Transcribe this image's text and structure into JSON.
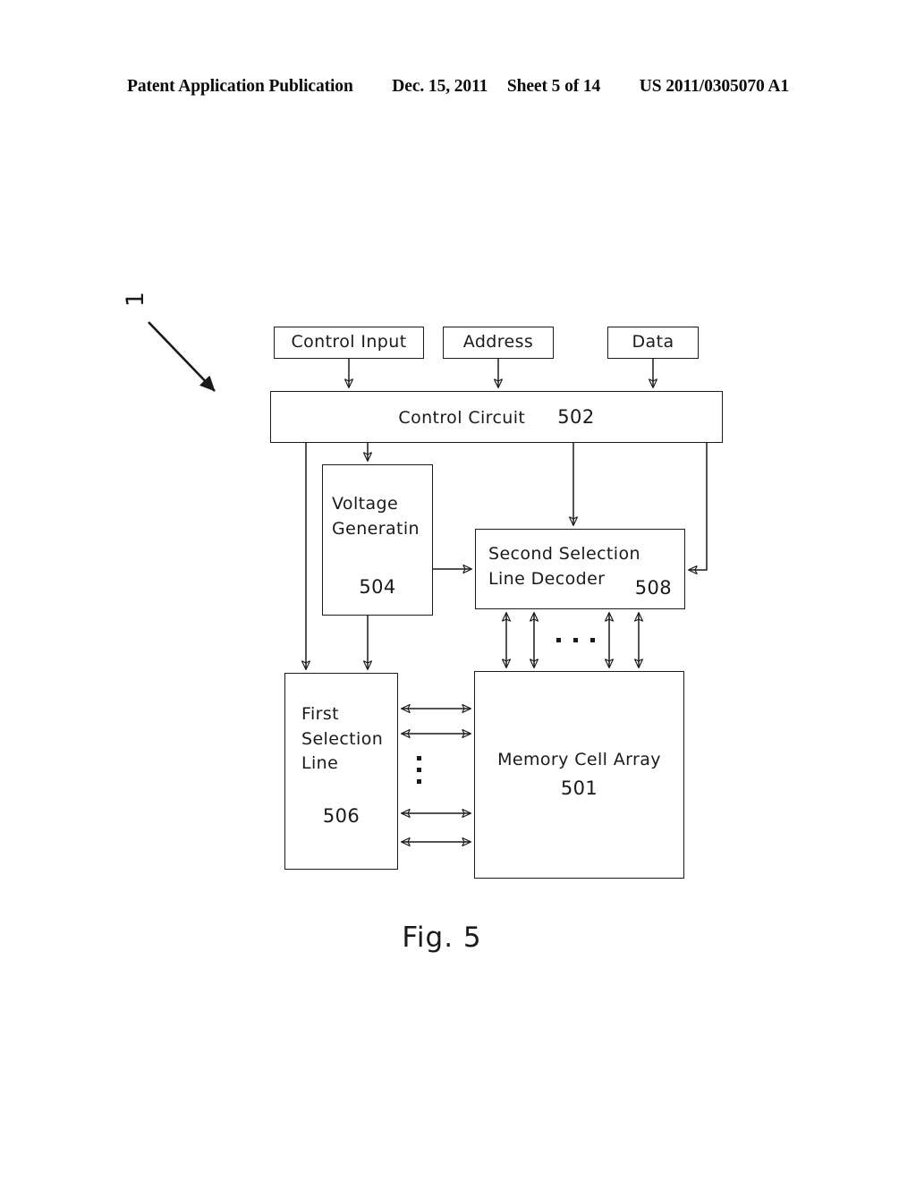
{
  "header": {
    "publication": "Patent Application Publication",
    "date": "Dec. 15, 2011",
    "sheet": "Sheet 5 of 14",
    "pub_number": "US 2011/0305070 A1"
  },
  "figure": {
    "caption": "Fig. 5",
    "system_ref": "1",
    "line_color": "#1a1a1a",
    "background": "#ffffff"
  },
  "blocks": {
    "control_input": {
      "label": "Control Input"
    },
    "address": {
      "label": "Address"
    },
    "data": {
      "label": "Data"
    },
    "control_circuit": {
      "label": "Control Circuit",
      "ref": "502"
    },
    "voltage_generation": {
      "line1": "Voltage",
      "line2": "Generatin",
      "ref": "504"
    },
    "second_selection_line_decoder": {
      "line1": "Second Selection",
      "line2": "Line Decoder",
      "ref": "508"
    },
    "first_selection_line": {
      "line1": "First",
      "line2": "Selection",
      "line3": "Line",
      "ref": "506"
    },
    "memory_cell_array": {
      "label": "Memory Cell Array",
      "ref": "501"
    }
  },
  "ellipses": {
    "decoder_to_array": "...",
    "firstsel_to_array": "⋮"
  }
}
